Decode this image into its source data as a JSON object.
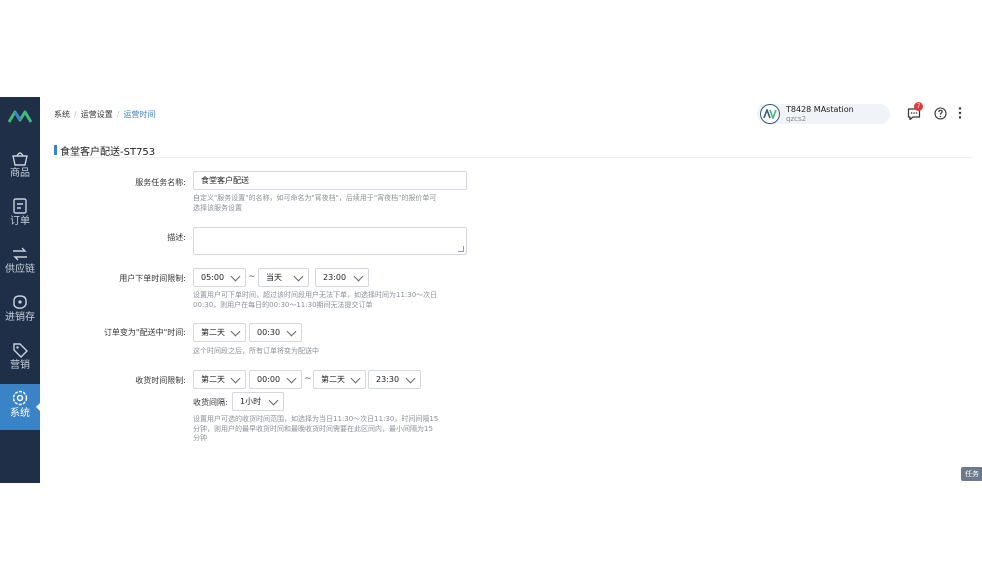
{
  "breadcrumb": {
    "items": [
      "系统",
      "运营设置",
      "运营时间"
    ]
  },
  "sidebar": {
    "items": [
      {
        "label": "商品",
        "icon": "basket-icon"
      },
      {
        "label": "订单",
        "icon": "order-icon"
      },
      {
        "label": "供应链",
        "icon": "exchange-icon"
      },
      {
        "label": "进销存",
        "icon": "warehouse-icon"
      },
      {
        "label": "营销",
        "icon": "tag-icon"
      },
      {
        "label": "系统",
        "icon": "settings-icon",
        "active": true
      }
    ]
  },
  "header": {
    "user_name": "T8428 MAstation",
    "user_code": "qzcs2",
    "message_count": "7",
    "avatar_text": "AV"
  },
  "page": {
    "title": "食堂客户配送-ST753"
  },
  "form": {
    "service_name": {
      "label": "服务任务名称:",
      "value": "食堂客户配送",
      "hint_line1": "自定义\"服务设置\"的名称，如可命名为\"宵夜档\"，后续用于\"宵夜档\"的报价单可",
      "hint_line2": "选择该服务设置"
    },
    "description": {
      "label": "描述:",
      "value": ""
    },
    "order_time": {
      "label": "用户下单时间限制:",
      "start": "05:00",
      "separator": "~",
      "end_day": "当天",
      "end_time": "23:00",
      "hint_line1": "设置用户可下单时间，超过该时间段用户无法下单，如选择时间为11:30～次日",
      "hint_line2": "00:30，则用户在每日的00:30～11:30期间无法提交订单"
    },
    "delivery_change": {
      "label": "订单变为\"配送中\"时间:",
      "day": "第二天",
      "time": "00:30",
      "hint_line1": "这个时间段之后，所有订单将变为配送中"
    },
    "receive_time": {
      "label": "收货时间限制:",
      "start_day": "第二天",
      "start_time": "00:00",
      "separator": "~",
      "end_day": "第二天",
      "end_time": "23:30",
      "interval_label": "收货间隔:",
      "interval": "1小时",
      "hint_line1": "设置用户可选的收货时间范围，如选择为当日11:30～次日11:30，时间间隔15",
      "hint_line2": "分钟，则用户的最早收货时间和最晚收货时间需要在此区间内，最小间隔为15",
      "hint_line3": "分钟"
    }
  },
  "task_button": "任务",
  "colors": {
    "sidebar_bg": "#1f2f47",
    "accent": "#3b83c7",
    "badge": "#e4393c"
  }
}
